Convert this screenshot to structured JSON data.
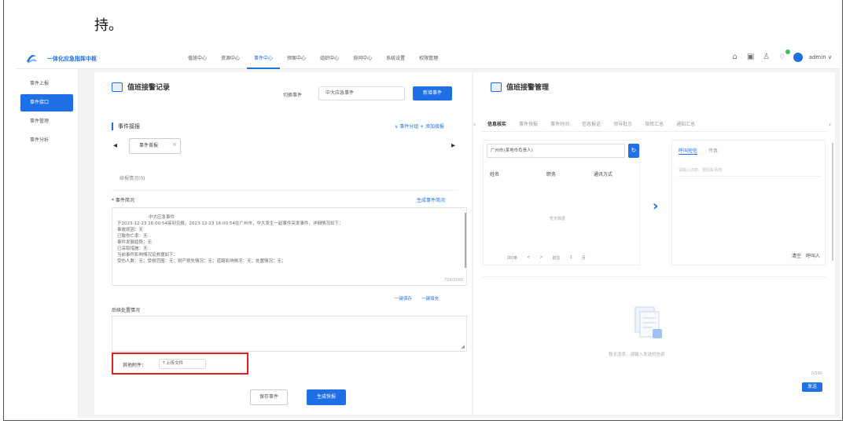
{
  "doc": {
    "text": "持。"
  },
  "app": {
    "brand": "一体化应急指挥中枢",
    "nav": [
      "值班中心",
      "资源中心",
      "事件中心",
      "预案中心",
      "组织中心",
      "协同中心",
      "系统设置",
      "权限管理"
    ],
    "nav_active_index": 2,
    "user": "admin ∨",
    "accent": "#1f6fe5"
  },
  "sidebar": {
    "items": [
      {
        "label": "事件上报"
      },
      {
        "label": "事件接口"
      },
      {
        "label": "事件管理"
      },
      {
        "label": "事件分析"
      }
    ],
    "active_index": 1
  },
  "left": {
    "title": "值班接警记录",
    "filter_label": "切换事件",
    "filter_value": "中大应急事件",
    "switch_button": "新增事件",
    "section_title": "事件接报",
    "collapse_link": "∨ 事件分组",
    "add_link": "+ 添加接报",
    "event_tab": "事件首报",
    "sub_label": "续报情况(0)",
    "desc_label": "* 事件简况",
    "report_link": "生成事件简况",
    "desc_lines": [
      "中大应急事件",
      "于2023-12-23 16:00:54接到见报，2023-12-23 16:00:54在广州市，中大发生一起事件突发事件，详细情况如下：",
      "事故原因：无",
      "已致伤亡率：无",
      "事件发展趋势：无",
      "已采取措施：无",
      "当前事件影响情况及救援如下：",
      "受伤人数：无；受损范围：无；财产损失情况：无；道路影响情况：无；处置情况：无；"
    ],
    "desc_count": "719/2000",
    "link_small_1": "一键保存",
    "link_small_2": "一键填充",
    "later_label": "后续处置情况",
    "upload_label": "其他附件：",
    "upload_button": "⤒ 上传文件",
    "save_button": "保存事件",
    "generate_button": "生成快报"
  },
  "right": {
    "title": "值班接警管理",
    "tabs": [
      "信息核实",
      "事件快报",
      "事件时间",
      "信息报送",
      "领导批示",
      "指挥汇总",
      "通知汇总"
    ],
    "contact_select": "广州市(某地市负责人)",
    "headers": [
      "姓名",
      "职务",
      "通讯方式"
    ],
    "empty": "暂无数据",
    "pager": [
      "共0条",
      "<",
      ">",
      "前往",
      "1",
      "页"
    ],
    "call_tabs": [
      "呼叫短信",
      "传真"
    ],
    "call_placeholder": "请输入内容，按回车添加",
    "call_actions": [
      "清空",
      "呼叫人"
    ],
    "msg_text": "暂无消息，请输入发送的信息",
    "msg_count": "0/500",
    "send_button": "发送"
  }
}
